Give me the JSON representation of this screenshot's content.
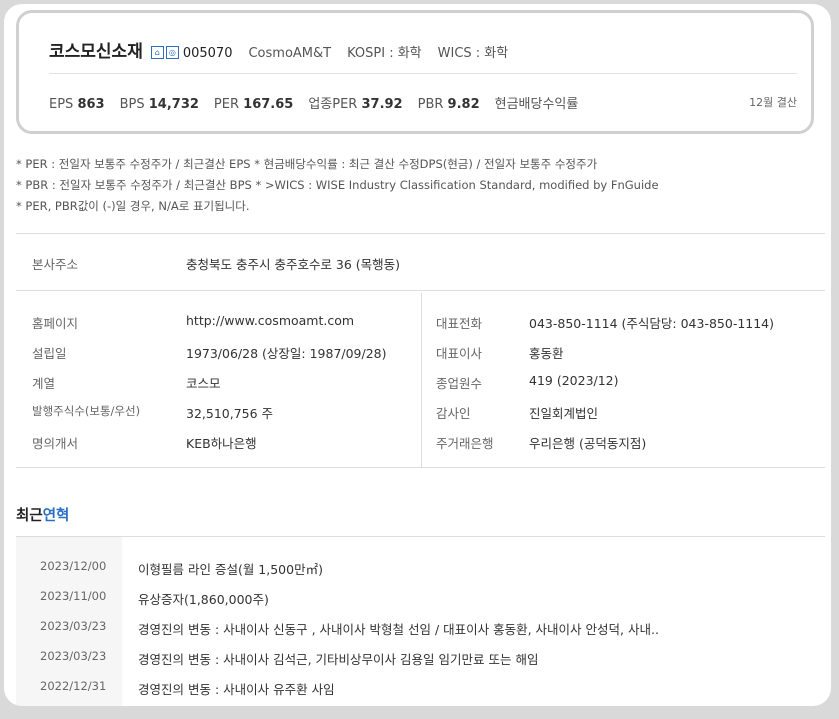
{
  "company": {
    "name": "코스모신소재",
    "badge1": "⌂",
    "badge2": "◎",
    "code": "005070",
    "eng_name": "CosmoAM&T",
    "market": "KOSPI : 화학",
    "wics": "WICS : 화학"
  },
  "stats": [
    {
      "label": "EPS",
      "value": "863"
    },
    {
      "label": "BPS",
      "value": "14,732"
    },
    {
      "label": "PER",
      "value": "167.65"
    },
    {
      "label": "업종PER",
      "value": "37.92"
    },
    {
      "label": "PBR",
      "value": "9.82"
    },
    {
      "label": "현금배당수익률",
      "value": ""
    }
  ],
  "settlement": "12월 결산",
  "notes": [
    "* PER : 전일자 보통주 수정주가 / 최근결산 EPS * 현금배당수익률 : 최근 결산 수정DPS(현금) / 전일자 보통주 수정주가",
    "* PBR : 전일자 보통주 수정주가 / 최근결산 BPS * >WICS : WISE Industry Classification Standard, modified by FnGuide",
    "* PER, PBR값이 (-)일 경우, N/A로 표기됩니다."
  ],
  "address": {
    "label": "본사주소",
    "value": "충청북도 충주시 충주호수로 36 (목행동)"
  },
  "info_left": [
    {
      "label": "홈페이지",
      "value": "http://www.cosmoamt.com"
    },
    {
      "label": "설립일",
      "value": "1973/06/28 (상장일: 1987/09/28)"
    },
    {
      "label": "계열",
      "value": "코스모"
    },
    {
      "label": "발행주식수(보통/우선)",
      "value": "32,510,756 주"
    },
    {
      "label": "명의개서",
      "value": "KEB하나은행"
    }
  ],
  "info_right": [
    {
      "label": "대표전화",
      "value": "043-850-1114 (주식담당: 043-850-1114)"
    },
    {
      "label": "대표이사",
      "value": "홍동환"
    },
    {
      "label": "종업원수",
      "value": "419 (2023/12)"
    },
    {
      "label": "감사인",
      "value": "진일회계법인"
    },
    {
      "label": "주거래은행",
      "value": "우리은행 (공덕동지점)"
    }
  ],
  "history_title": {
    "part1": "최근",
    "part2": "연혁"
  },
  "history": [
    {
      "date": "2023/12/00",
      "text": "이형필름 라인 증설(월 1,500만㎡)"
    },
    {
      "date": "2023/11/00",
      "text": "유상증자(1,860,000주)"
    },
    {
      "date": "2023/03/23",
      "text": "경영진의 변동 : 사내이사 신동구 , 사내이사 박형철 선임 / 대표이사 홍동환, 사내이사 안성덕, 사내.."
    },
    {
      "date": "2023/03/23",
      "text": "경영진의 변동 : 사내이사 김석근, 기타비상무이사 김용일 임기만료 또는 해임"
    },
    {
      "date": "2022/12/31",
      "text": "경영진의 변동 : 사내이사 유주환 사임"
    }
  ]
}
